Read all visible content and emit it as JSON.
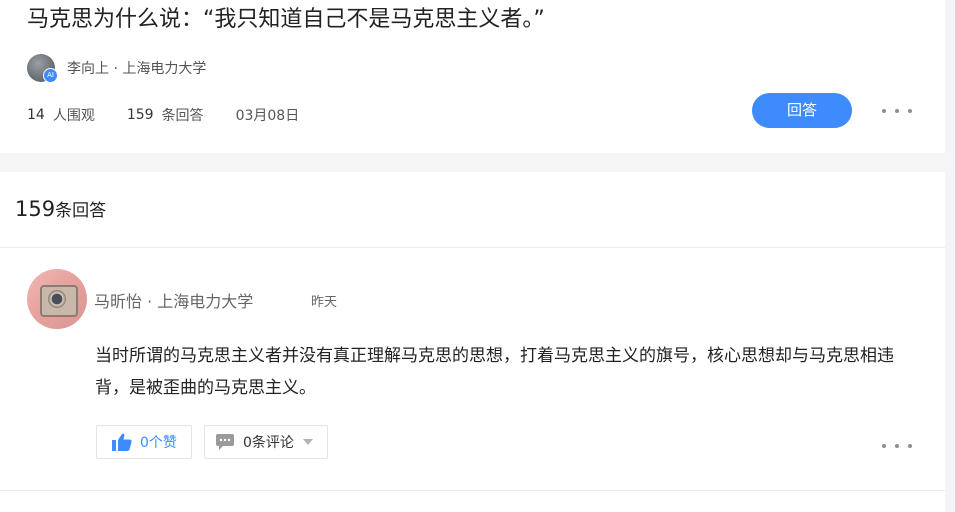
{
  "question": {
    "title": "马克思为什么说：“我只知道自己不是马克思主义者。”",
    "author": "李向上 · 上海电力大学",
    "author_badge": "AI",
    "views": "14",
    "views_label": "人围观",
    "answers": "159",
    "answers_label": "条回答",
    "date": "03月08日",
    "answer_button": "回答"
  },
  "answers_section": {
    "count": "159",
    "count_label": "条回答"
  },
  "answer": {
    "author": "马昕怡 · 上海电力大学",
    "time": "昨天",
    "body": "当时所谓的马克思主义者并没有真正理解马克思的思想，打着马克思主义的旗号，核心思想却与马克思相违背，是被歪曲的马克思主义。",
    "like_label": "0个赞",
    "comment_label": "0条评论"
  },
  "icons": {
    "like": "thumbs-up-icon",
    "comment": "comment-bubble-icon",
    "more": "more-dots-icon",
    "caret": "caret-down-icon"
  },
  "colors": {
    "accent": "#3d8bfd",
    "background": "#f4f5f7"
  }
}
